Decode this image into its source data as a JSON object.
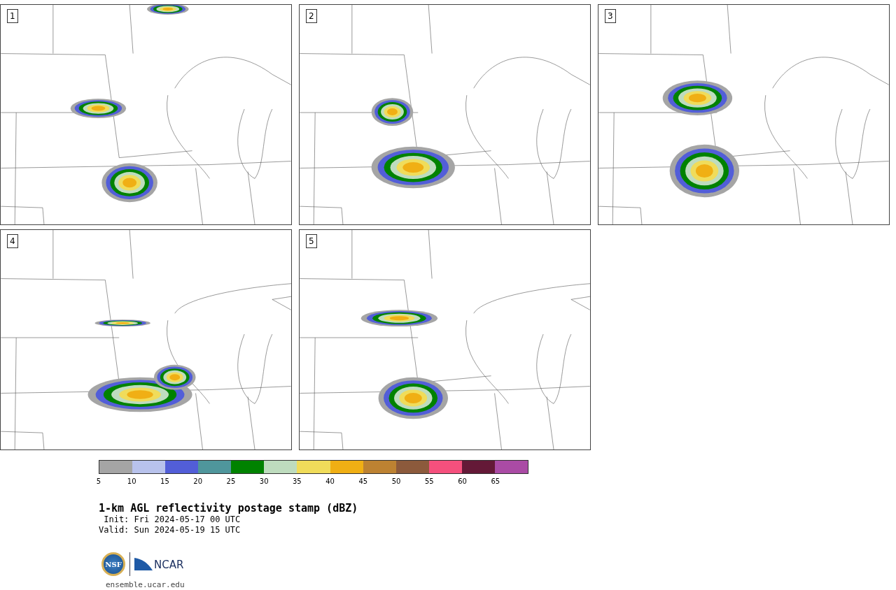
{
  "panels": [
    {
      "label": "1"
    },
    {
      "label": "2"
    },
    {
      "label": "3"
    },
    {
      "label": "4"
    },
    {
      "label": "5"
    }
  ],
  "colorbar": {
    "segments": [
      {
        "color": "#a5a5a5"
      },
      {
        "color": "#b8c2ec"
      },
      {
        "color": "#525ed8"
      },
      {
        "color": "#4f969c"
      },
      {
        "color": "#008200"
      },
      {
        "color": "#bedcbe"
      },
      {
        "color": "#f0dc5a"
      },
      {
        "color": "#f0af14"
      },
      {
        "color": "#bd8232"
      },
      {
        "color": "#8c5a3c"
      },
      {
        "color": "#f5507d"
      },
      {
        "color": "#641937"
      },
      {
        "color": "#aa4ba5"
      }
    ],
    "ticks": [
      "5",
      "10",
      "15",
      "20",
      "25",
      "30",
      "35",
      "40",
      "45",
      "50",
      "55",
      "60",
      "65"
    ]
  },
  "title": "1-km AGL reflectivity postage stamp (dBZ)",
  "init": " Init: Fri 2024-05-17 00 UTC",
  "valid": "Valid: Sun 2024-05-19 15 UTC",
  "logos": {
    "nsf": "NSF",
    "ncar": "NCAR"
  },
  "site": "ensemble.ucar.edu"
}
